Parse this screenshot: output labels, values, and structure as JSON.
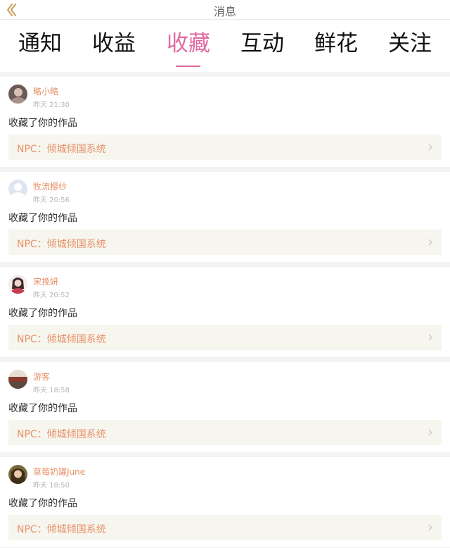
{
  "header": {
    "title": "消息"
  },
  "tabs": [
    {
      "label": "通知",
      "active": false
    },
    {
      "label": "收益",
      "active": false
    },
    {
      "label": "收藏",
      "active": true
    },
    {
      "label": "互动",
      "active": false
    },
    {
      "label": "鲜花",
      "active": false
    },
    {
      "label": "关注",
      "active": false
    }
  ],
  "colors": {
    "accent": "#e06aa2",
    "username": "#e8926a",
    "work_bg": "#f6f5ee",
    "divider": "#f3f3f3"
  },
  "notifications": [
    {
      "username": "略小略",
      "time": "昨天 21:30",
      "action": "收藏了你的作品",
      "work": "NPC：倾城倾国系统",
      "avatar_icon": "avatar-photo-icon"
    },
    {
      "username": "牧流樱纱",
      "time": "昨天 20:56",
      "action": "收藏了你的作品",
      "work": "NPC：倾城倾国系统",
      "avatar_icon": "default-avatar-icon"
    },
    {
      "username": "宋挽妍",
      "time": "昨天 20:52",
      "action": "收藏了你的作品",
      "work": "NPC：倾城倾国系统",
      "avatar_icon": "avatar-photo-icon"
    },
    {
      "username": "游客",
      "time": "昨天 18:58",
      "action": "收藏了你的作品",
      "work": "NPC：倾城倾国系统",
      "avatar_icon": "avatar-photo-icon"
    },
    {
      "username": "草莓奶罐June",
      "time": "昨天 18:50",
      "action": "收藏了你的作品",
      "work": "NPC：倾城倾国系统",
      "avatar_icon": "avatar-photo-icon"
    }
  ]
}
